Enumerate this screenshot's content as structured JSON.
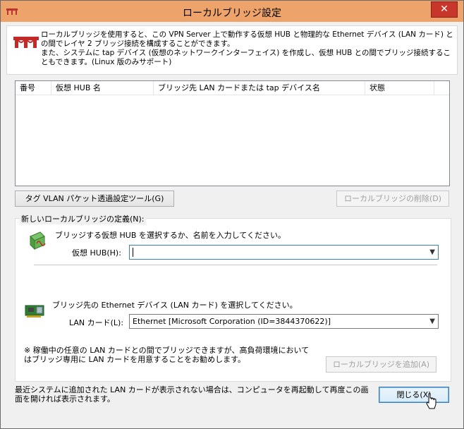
{
  "window": {
    "title": "ローカルブリッジ設定",
    "close_glyph": "✕"
  },
  "description": "ローカルブリッジを使用すると、この VPN Server 上で動作する仮想 HUB と物理的な Ethernet デバイス (LAN カード) との間でレイヤ 2 ブリッジ接続を構成することができます。\nまた、システムに tap デバイス (仮想のネットワークインターフェイス) を作成し、仮想 HUB との間でブリッジ接続することもできます。(Linux 版のみサポート)",
  "bridge_list": {
    "columns": [
      "番号",
      "仮想 HUB 名",
      "ブリッジ先 LAN カードまたは tap デバイス名",
      "状態"
    ],
    "rows": []
  },
  "buttons": {
    "vlan_tool": "タグ VLAN パケット透過設定ツール(G)",
    "delete_bridge": "ローカルブリッジの削除(D)",
    "add_bridge": "ローカルブリッジを追加(A)",
    "close": "閉じる(X)"
  },
  "new_bridge": {
    "legend": "新しいローカルブリッジの定義(N):",
    "hub_prompt": "ブリッジする仮想 HUB を選択するか、名前を入力してください。",
    "hub_label": "仮想 HUB(H):",
    "hub_value": "",
    "lan_prompt": "ブリッジ先の Ethernet デバイス (LAN カード) を選択してください。",
    "lan_label": "LAN カード(L):",
    "lan_value": "Ethernet [Microsoft Corporation (ID=3844370622)]",
    "note": "※ 稼働中の任意の LAN カードとの間でブリッジできますが、高負荷環境においてはブリッジ専用に LAN カードを用意することをお勧めします。"
  },
  "footer_note": "最近システムに追加された LAN カードが表示されない場合は、コンピュータを再起動して再度この画面を開ければ表示されます。",
  "colors": {
    "titlebar": "#eda36a",
    "close_button": "#c7352b"
  }
}
